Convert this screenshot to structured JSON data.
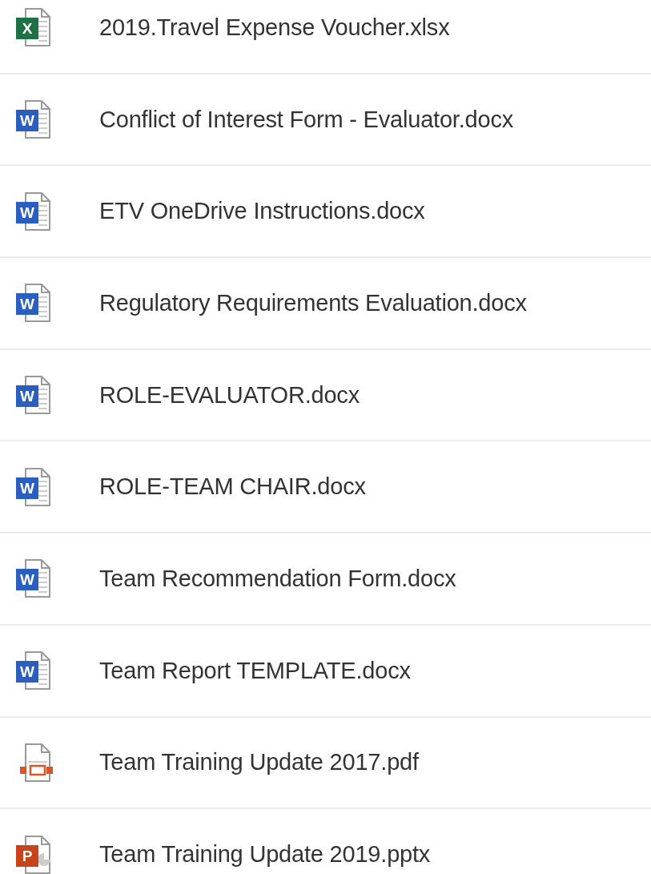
{
  "files": [
    {
      "name": "2019.Travel Expense Voucher.xlsx",
      "kind": "spreadsheet",
      "badge": "X"
    },
    {
      "name": "Conflict of Interest Form - Evaluator.docx",
      "kind": "document",
      "badge": "W"
    },
    {
      "name": "ETV OneDrive Instructions.docx",
      "kind": "document",
      "badge": "W"
    },
    {
      "name": "Regulatory Requirements Evaluation.docx",
      "kind": "document",
      "badge": "W"
    },
    {
      "name": "ROLE-EVALUATOR.docx",
      "kind": "document",
      "badge": "W"
    },
    {
      "name": "ROLE-TEAM CHAIR.docx",
      "kind": "document",
      "badge": "W"
    },
    {
      "name": "Team Recommendation Form.docx",
      "kind": "document",
      "badge": "W"
    },
    {
      "name": "Team Report TEMPLATE.docx",
      "kind": "document",
      "badge": "W"
    },
    {
      "name": "Team Training Update 2017.pdf",
      "kind": "pdf"
    },
    {
      "name": "Team Training Update 2019.pptx",
      "kind": "presentation",
      "badge": "P"
    }
  ]
}
